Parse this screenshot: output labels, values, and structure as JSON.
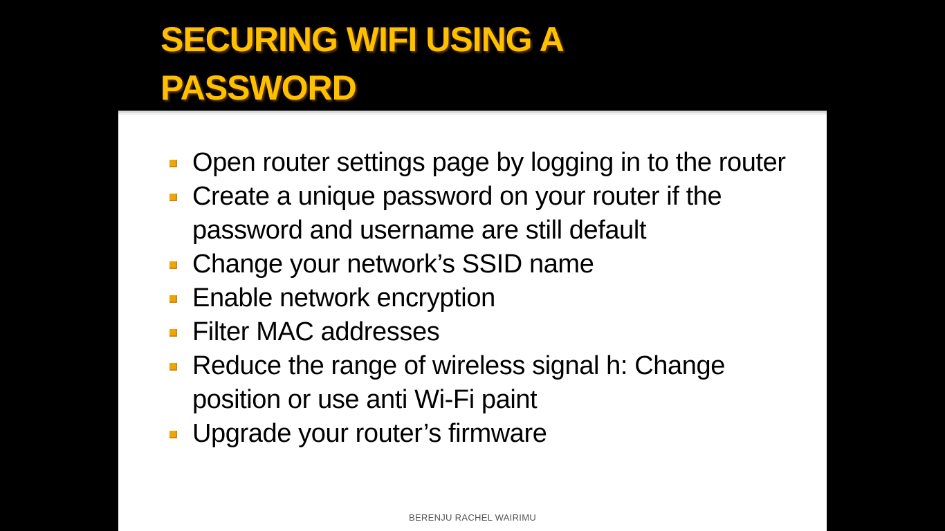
{
  "slide": {
    "title": "SECURING WIFI USING A\nPASSWORD",
    "bullets": [
      "Open router settings page by logging in to the router",
      "Create a unique password on your router if the password and username are still default",
      "Change your network’s SSID name",
      "Enable network encryption",
      "Filter MAC addresses",
      "Reduce the range of wireless signal h: Change position or use anti Wi-Fi paint",
      "Upgrade your router’s firmware"
    ],
    "footer": "BERENJU RACHEL WAIRIMU"
  },
  "colors": {
    "background": "#000000",
    "title": "#FFC000",
    "panel": "#FFFFFF",
    "bullet_marker": "#F0A30A",
    "body_text": "#000000"
  },
  "icons": {
    "bullet_marker": "square-bullet-icon"
  }
}
